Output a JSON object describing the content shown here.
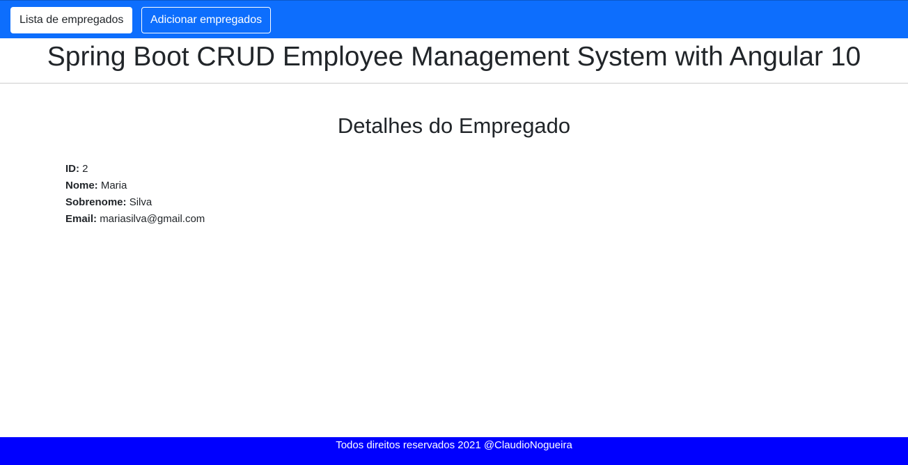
{
  "navbar": {
    "list_label": "Lista de empregados",
    "add_label": "Adicionar empregados",
    "background_color": "#0d6efd"
  },
  "header": {
    "title": "Spring Boot CRUD Employee Management System with Angular 10"
  },
  "main": {
    "section_title": "Detalhes do Empregado",
    "details": [
      {
        "label": "ID:",
        "value": "2"
      },
      {
        "label": "Nome:",
        "value": "Maria"
      },
      {
        "label": "Sobrenome:",
        "value": "Silva"
      },
      {
        "label": "Email:",
        "value": "mariasilva@gmail.com"
      }
    ]
  },
  "footer": {
    "text": "Todos direitos reservados 2021 @ClaudioNogueira",
    "background_color": "#0000ff"
  }
}
